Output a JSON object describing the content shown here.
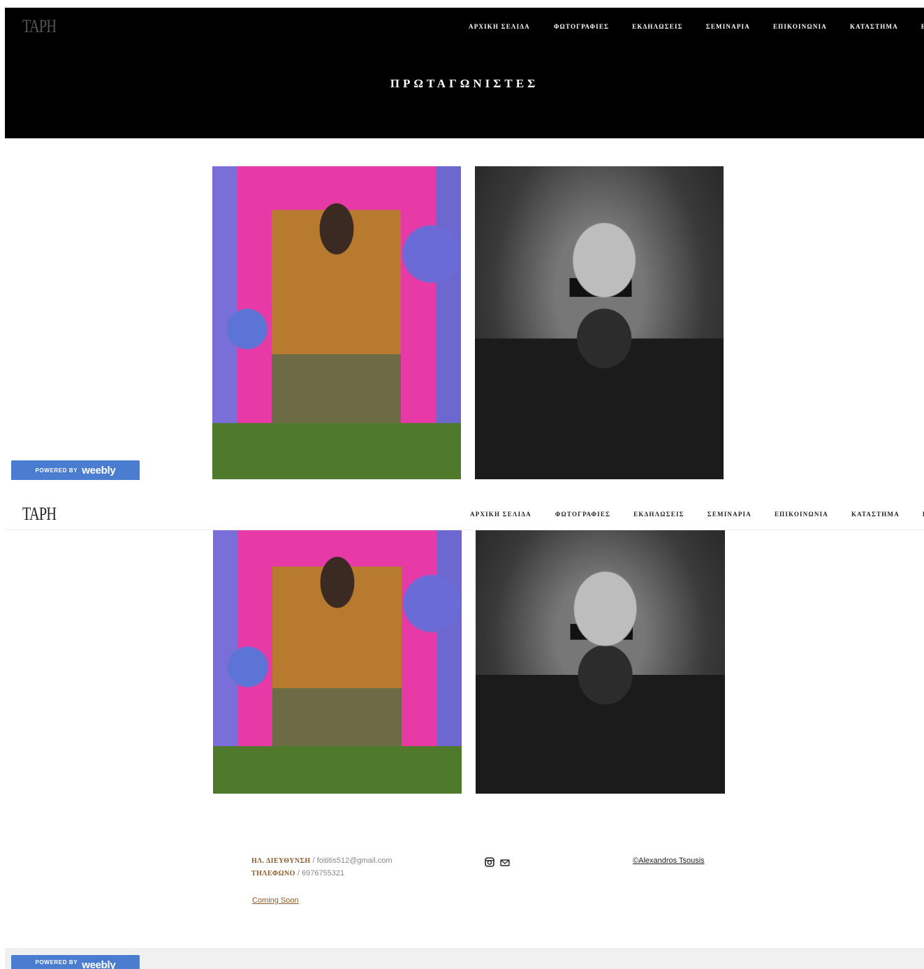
{
  "brand": {
    "logo": "TAPH"
  },
  "nav": {
    "items": [
      "ΑΡΧΙΚΗ ΣΕΛΙΔΑ",
      "ΦΩΤΟΓΡΑΦΙΕΣ",
      "ΕΚΔΗΛΩΣΕΙΣ",
      "ΣΕΜΙΝΑΡΙΑ",
      "ΕΠΙΚΟΙΝΩΝΙΑ",
      "ΚΑΤΑΣΤΗΜΑ",
      "EN"
    ]
  },
  "hero": {
    "title": "ΠΡΩΤΑΓΩΝΙΣΤΕΣ"
  },
  "weebly": {
    "powered_by": "POWERED BY",
    "brand": "weebly"
  },
  "footer": {
    "email_label": "ΗΛ. ΔΙΕΥΘΥΝΣΗ",
    "email": "foititis512@gmail.com",
    "phone_label": "ΤΗΛΕΦΩΝΟ",
    "phone": "6976755321",
    "coming_soon": "Coming Soon",
    "copyright": "©Alexandros Tsousis",
    "separator": " / "
  },
  "colors": {
    "accent": "#8b5a2b",
    "weebly_blue": "#4a7dd0",
    "hero_bg": "#000000"
  },
  "icons": [
    "instagram-icon",
    "mail-icon"
  ]
}
